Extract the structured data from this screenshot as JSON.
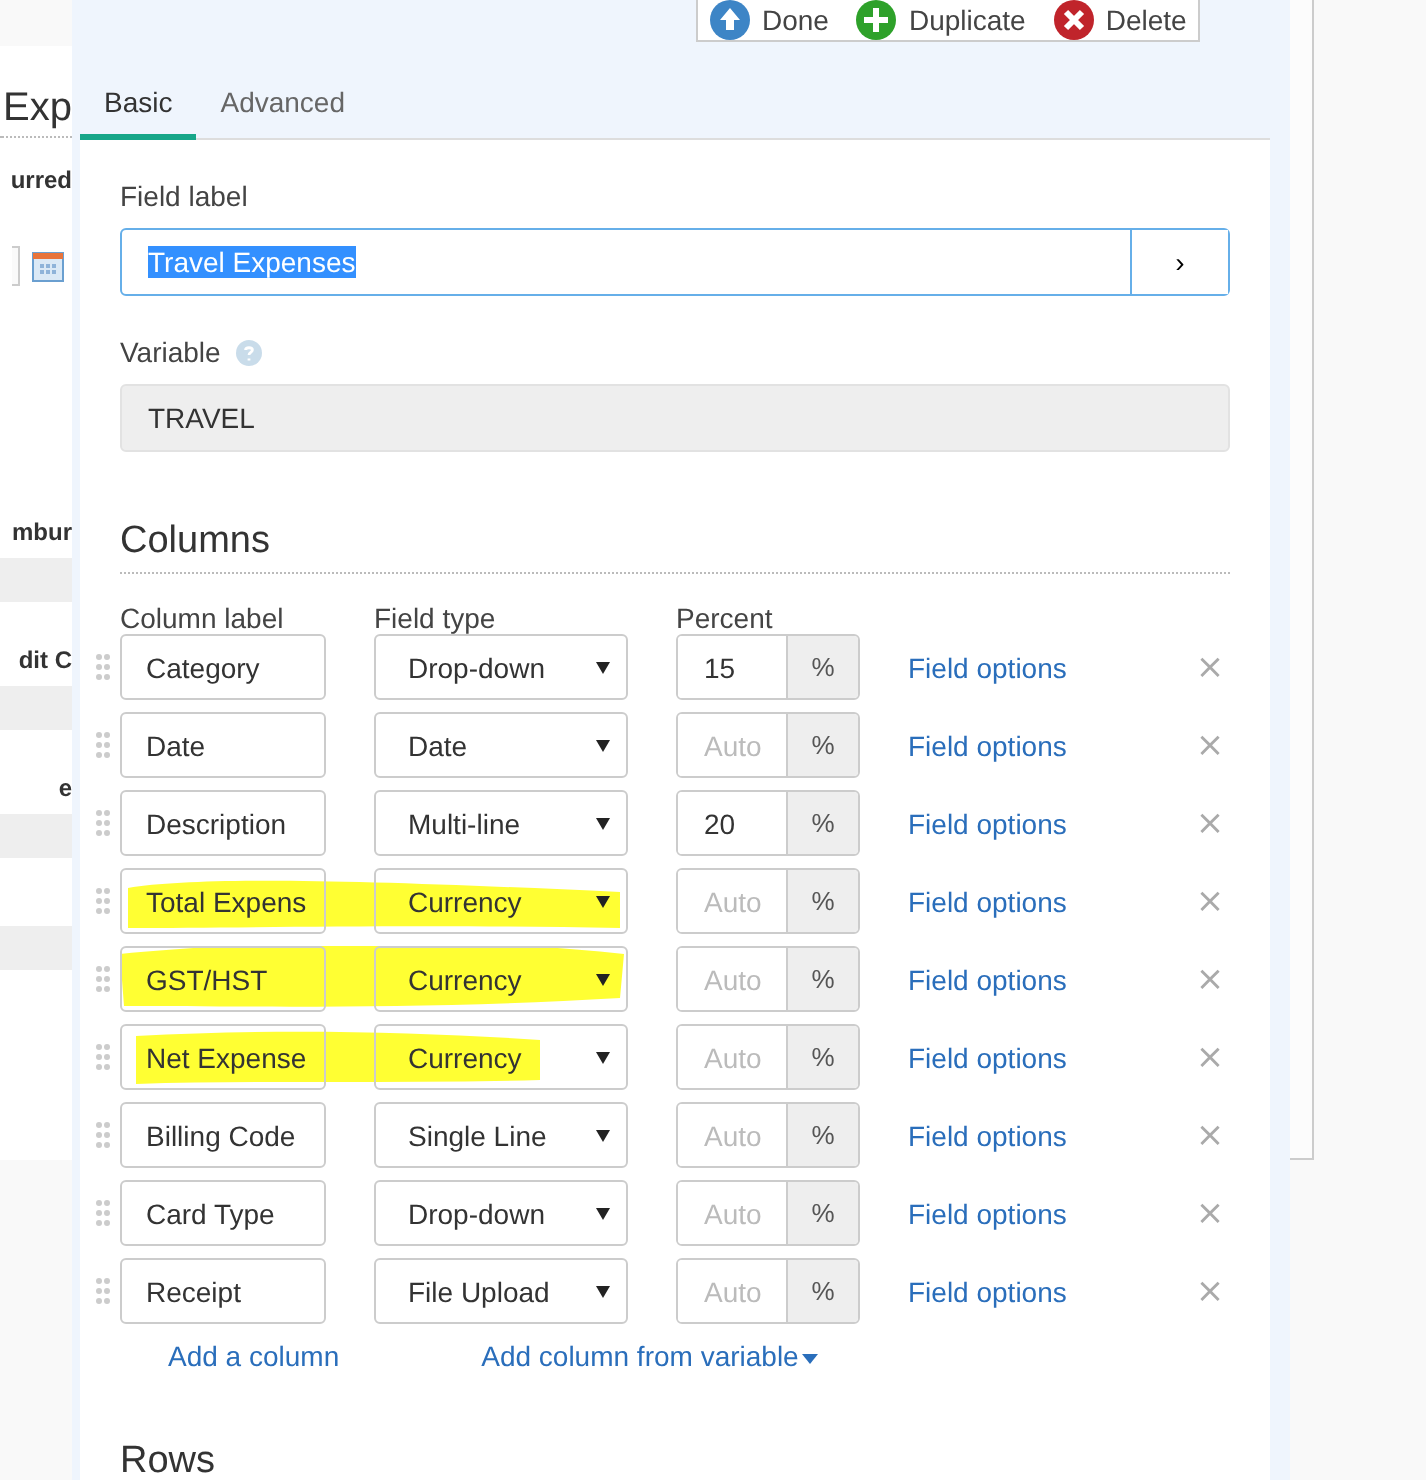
{
  "side_panel": {
    "title": "Exp",
    "items": [
      {
        "kind": "label",
        "text": "urred"
      },
      {
        "kind": "date_field"
      },
      {
        "kind": "spacer"
      },
      {
        "kind": "label",
        "text": "mbur"
      },
      {
        "kind": "field"
      },
      {
        "kind": "label",
        "text": "dit C"
      },
      {
        "kind": "field"
      },
      {
        "kind": "label",
        "text": "e"
      },
      {
        "kind": "field"
      },
      {
        "kind": "spacer_small"
      },
      {
        "kind": "field"
      }
    ]
  },
  "toolbar": [
    {
      "kind": "done",
      "label": "Done"
    },
    {
      "kind": "duplicate",
      "label": "Duplicate"
    },
    {
      "kind": "delete",
      "label": "Delete"
    }
  ],
  "tabs": [
    {
      "label": "Basic",
      "selected": true
    },
    {
      "label": "Advanced",
      "selected": false
    }
  ],
  "field_label": {
    "label": "Field label",
    "value": "Travel Expenses",
    "text_selected": true,
    "button": "›"
  },
  "variable": {
    "label": "Variable",
    "value": "TRAVEL"
  },
  "columns_section": {
    "title": "Columns",
    "headers": [
      "Column label",
      "Field type",
      "Percent"
    ],
    "rows": [
      {
        "label": "Category",
        "field_type": "Drop-down",
        "percent": "15",
        "unit": "%",
        "options_link": "Field options",
        "remove": "×",
        "highlighted": false
      },
      {
        "label": "Date",
        "field_type": "Date",
        "placeholder": "Auto",
        "unit": "%",
        "options_link": "Field options",
        "remove": "×",
        "highlighted": false
      },
      {
        "label": "Description",
        "field_type": "Multi-line",
        "percent": "20",
        "unit": "%",
        "options_link": "Field options",
        "remove": "×",
        "highlighted": false
      },
      {
        "label": "Total Expens",
        "field_type": "Currency",
        "placeholder": "Auto",
        "unit": "%",
        "options_link": "Field options",
        "remove": "×",
        "highlighted": true
      },
      {
        "label": "GST/HST",
        "field_type": "Currency",
        "placeholder": "Auto",
        "unit": "%",
        "options_link": "Field options",
        "remove": "×",
        "highlighted": true
      },
      {
        "label": "Net Expense",
        "field_type": "Currency",
        "placeholder": "Auto",
        "unit": "%",
        "options_link": "Field options",
        "remove": "×",
        "highlighted": true
      },
      {
        "label": "Billing Code",
        "field_type": "Single Line",
        "placeholder": "Auto",
        "unit": "%",
        "options_link": "Field options",
        "remove": "×",
        "highlighted": false
      },
      {
        "label": "Card Type",
        "field_type": "Drop-down",
        "placeholder": "Auto",
        "unit": "%",
        "options_link": "Field options",
        "remove": "×",
        "highlighted": false
      },
      {
        "label": "Receipt",
        "field_type": "File Upload",
        "placeholder": "Auto",
        "unit": "%",
        "options_link": "Field options",
        "remove": "×",
        "highlighted": false
      }
    ],
    "add_column": "Add a column",
    "add_from_variable": "Add column from variable"
  },
  "rows_section": {
    "title": "Rows"
  }
}
